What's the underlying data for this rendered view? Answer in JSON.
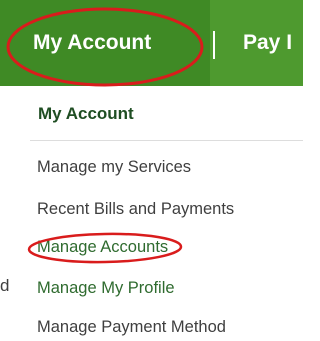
{
  "nav": {
    "tabs": [
      {
        "label": "My Account"
      },
      {
        "label": "Pay I"
      }
    ]
  },
  "menu": {
    "heading": "My Account",
    "items": [
      {
        "label": "Manage my Services"
      },
      {
        "label": "Recent Bills and Payments"
      },
      {
        "label": "Manage Accounts"
      },
      {
        "label": "Manage My Profile"
      },
      {
        "label": "Manage Payment Method"
      }
    ]
  },
  "stray_text": "d",
  "colors": {
    "nav_bg": "#4e9a2f",
    "nav_active_bg": "#3f8a25",
    "heading": "#1f4e23",
    "annotation": "#d91c1c"
  }
}
